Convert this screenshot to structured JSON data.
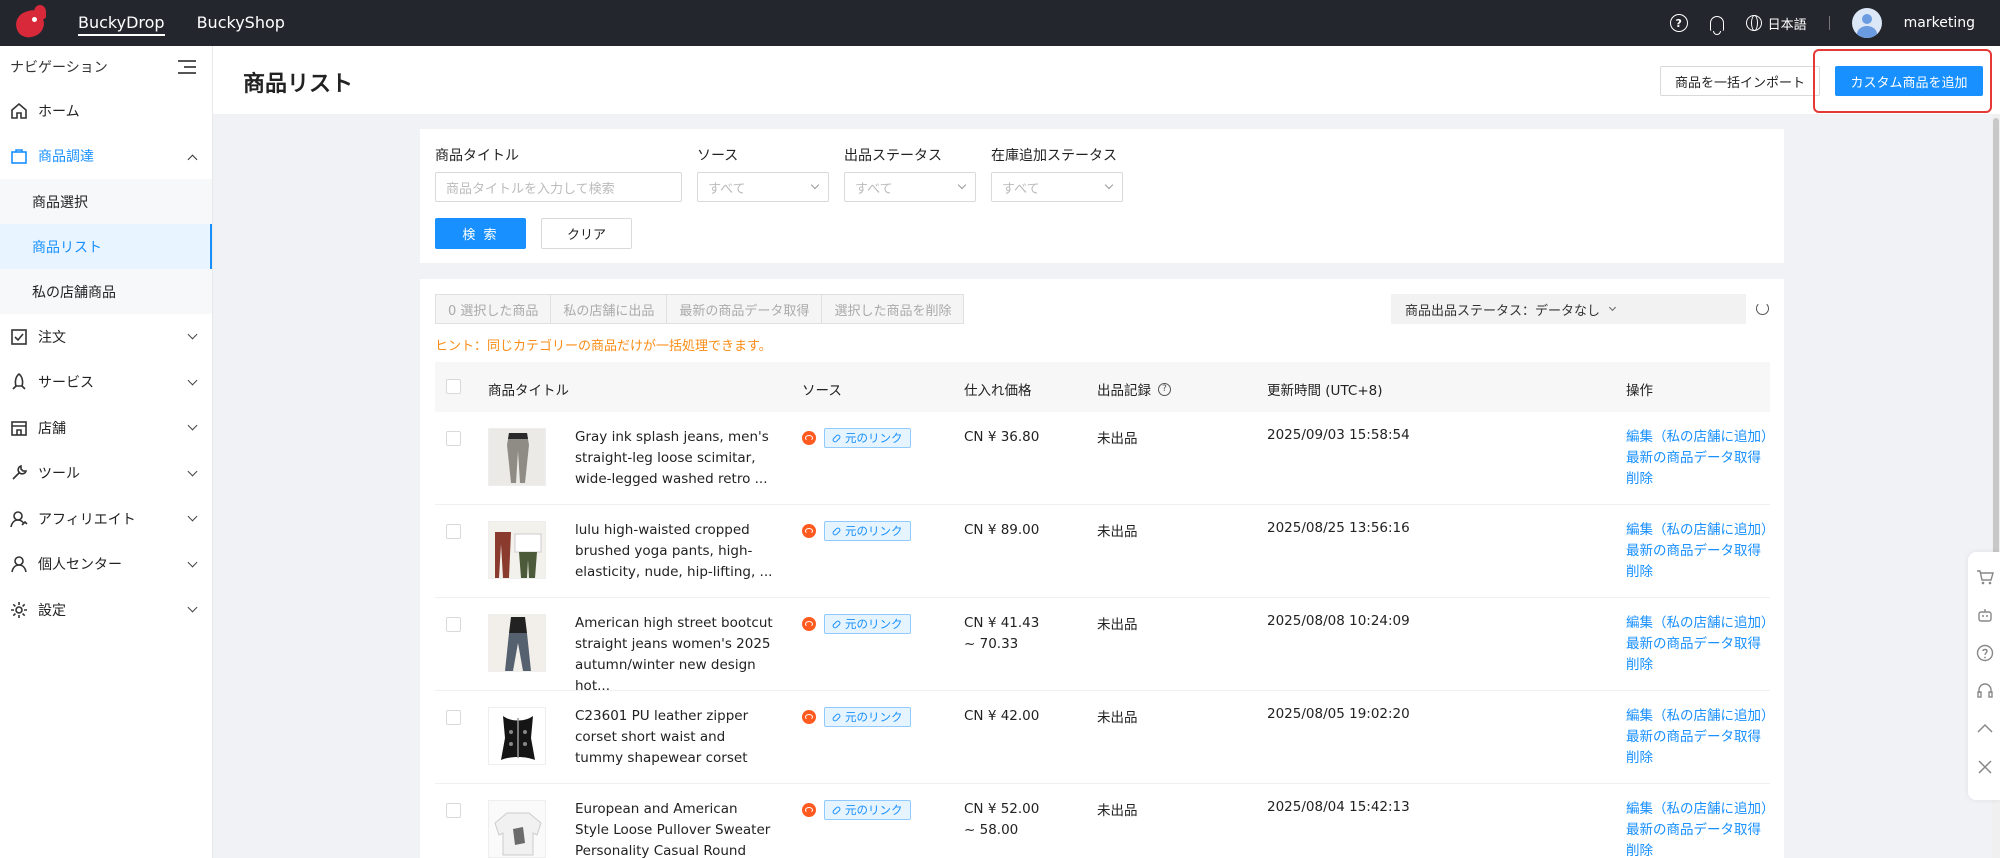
{
  "topbar": {
    "tabs": [
      "BuckyDrop",
      "BuckyShop"
    ],
    "help_icon_glyph": "?",
    "language": "日本語",
    "username": "marketing"
  },
  "sidebar": {
    "header": "ナビゲーション",
    "items": [
      {
        "label": "ホーム",
        "icon": "home-icon"
      },
      {
        "label": "商品調達",
        "icon": "bag-icon"
      },
      {
        "label": "注文",
        "icon": "order-icon"
      },
      {
        "label": "サービス",
        "icon": "rocket-icon"
      },
      {
        "label": "店舗",
        "icon": "store-icon"
      },
      {
        "label": "ツール",
        "icon": "wrench-icon"
      },
      {
        "label": "アフィリエイト",
        "icon": "affiliate-icon"
      },
      {
        "label": "個人センター",
        "icon": "user-icon"
      },
      {
        "label": "設定",
        "icon": "gear-icon"
      }
    ],
    "sub_items": [
      "商品選択",
      "商品リスト",
      "私の店舗商品"
    ]
  },
  "page": {
    "title": "商品リスト",
    "import_button": "商品を一括インポート",
    "add_button": "カスタム商品を追加"
  },
  "filters": {
    "title_label": "商品タイトル",
    "title_placeholder": "商品タイトルを入力して検索",
    "source_label": "ソース",
    "source_value": "すべて",
    "listing_label": "出品ステータス",
    "listing_value": "すべて",
    "stock_label": "在庫追加ステータス",
    "stock_value": "すべて",
    "search_button": "検 索",
    "clear_button": "クリア"
  },
  "toolbar": {
    "bulk_actions": [
      "0 選択した商品",
      "私の店舗に出品",
      "最新の商品データ取得",
      "選択した商品を削除"
    ],
    "status_filter": "商品出品ステータス：データなし",
    "hint": "ヒント：同じカテゴリーの商品だけが一括処理できます。"
  },
  "table": {
    "columns": [
      "商品タイトル",
      "ソース",
      "仕入れ価格",
      "出品記録",
      "更新時間 (UTC+8)",
      "操作"
    ],
    "source_tag": "元のリンク",
    "op_edit": "編集（私の店舗に追加）",
    "op_refresh": "最新の商品データ取得",
    "op_delete": "削除",
    "rows": [
      {
        "title": "Gray ink splash jeans, men's straight-leg loose scimitar, wide-legged washed retro ...",
        "price": "CN ¥ 36.80",
        "status": "未出品",
        "time": "2025/09/03 15:58:54"
      },
      {
        "title": "lulu high-waisted cropped brushed yoga pants, high-elasticity, nude, hip-lifting, ...",
        "price": "CN ¥ 89.00",
        "status": "未出品",
        "time": "2025/08/25 13:56:16"
      },
      {
        "title": "American high street bootcut straight jeans women's 2025 autumn/winter new design hot...",
        "price": "CN ¥ 41.43 ~ 70.33",
        "status": "未出品",
        "time": "2025/08/08 10:24:09"
      },
      {
        "title": "C23601 PU leather zipper corset short waist and tummy shapewear corset",
        "price": "CN ¥ 42.00",
        "status": "未出品",
        "time": "2025/08/05 19:02:20"
      },
      {
        "title": "European and American Style Loose Pullover Sweater Personality Casual Round Nec...",
        "price": "CN ¥ 52.00 ~ 58.00",
        "status": "未出品",
        "time": "2025/08/04 15:42:13"
      }
    ]
  },
  "colors": {
    "primary": "#1890ff",
    "topbar_bg": "#23262d",
    "hint": "#fa8c16",
    "highlight": "#e53935"
  }
}
